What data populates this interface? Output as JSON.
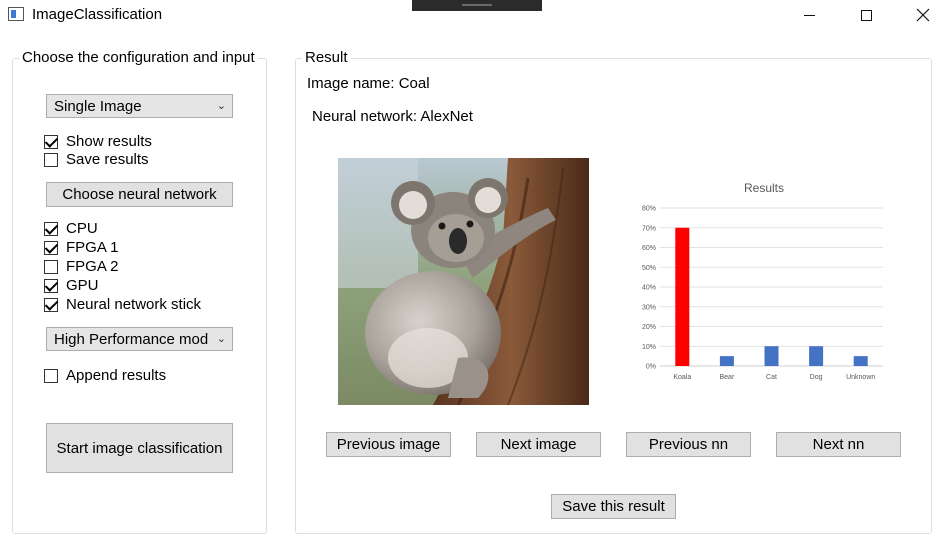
{
  "window": {
    "title": "ImageClassification",
    "icon": "app-window-icon",
    "controls": [
      "minimize-icon",
      "maximize-icon",
      "close-icon"
    ]
  },
  "config": {
    "legend": "Choose the configuration and input",
    "mode_select": "Single Image",
    "show_results": {
      "label": "Show results",
      "checked": true
    },
    "save_results": {
      "label": "Save results",
      "checked": false
    },
    "choose_nn_label": "Choose neural network",
    "devices": [
      {
        "label": "CPU",
        "checked": true
      },
      {
        "label": "FPGA 1",
        "checked": true
      },
      {
        "label": "FPGA 2",
        "checked": false
      },
      {
        "label": "GPU",
        "checked": true
      },
      {
        "label": "Neural network stick",
        "checked": true
      }
    ],
    "performance_select": "High Performance mod",
    "append_results": {
      "label": "Append results",
      "checked": false
    },
    "start_label": "Start image classification"
  },
  "result": {
    "legend": "Result",
    "image_name": "Image name: Coal",
    "neural_network": "Neural network: AlexNet",
    "buttons": {
      "previous_image": "Previous image",
      "next_image": "Next image",
      "previous_nn": "Previous nn",
      "next_nn": "Next nn",
      "save": "Save this result"
    }
  },
  "chart_data": {
    "type": "bar",
    "title": "Results",
    "categories": [
      "Koala",
      "Bear",
      "Cat",
      "Dog",
      "Unknown"
    ],
    "values": [
      70,
      5,
      10,
      10,
      5
    ],
    "colors": [
      "#ff0000",
      "#4472c4",
      "#4472c4",
      "#4472c4",
      "#4472c4"
    ],
    "ylim": [
      0,
      80
    ],
    "yticks": [
      "0%",
      "10%",
      "20%",
      "30%",
      "40%",
      "50%",
      "60%",
      "70%",
      "80%"
    ],
    "grid": true
  }
}
